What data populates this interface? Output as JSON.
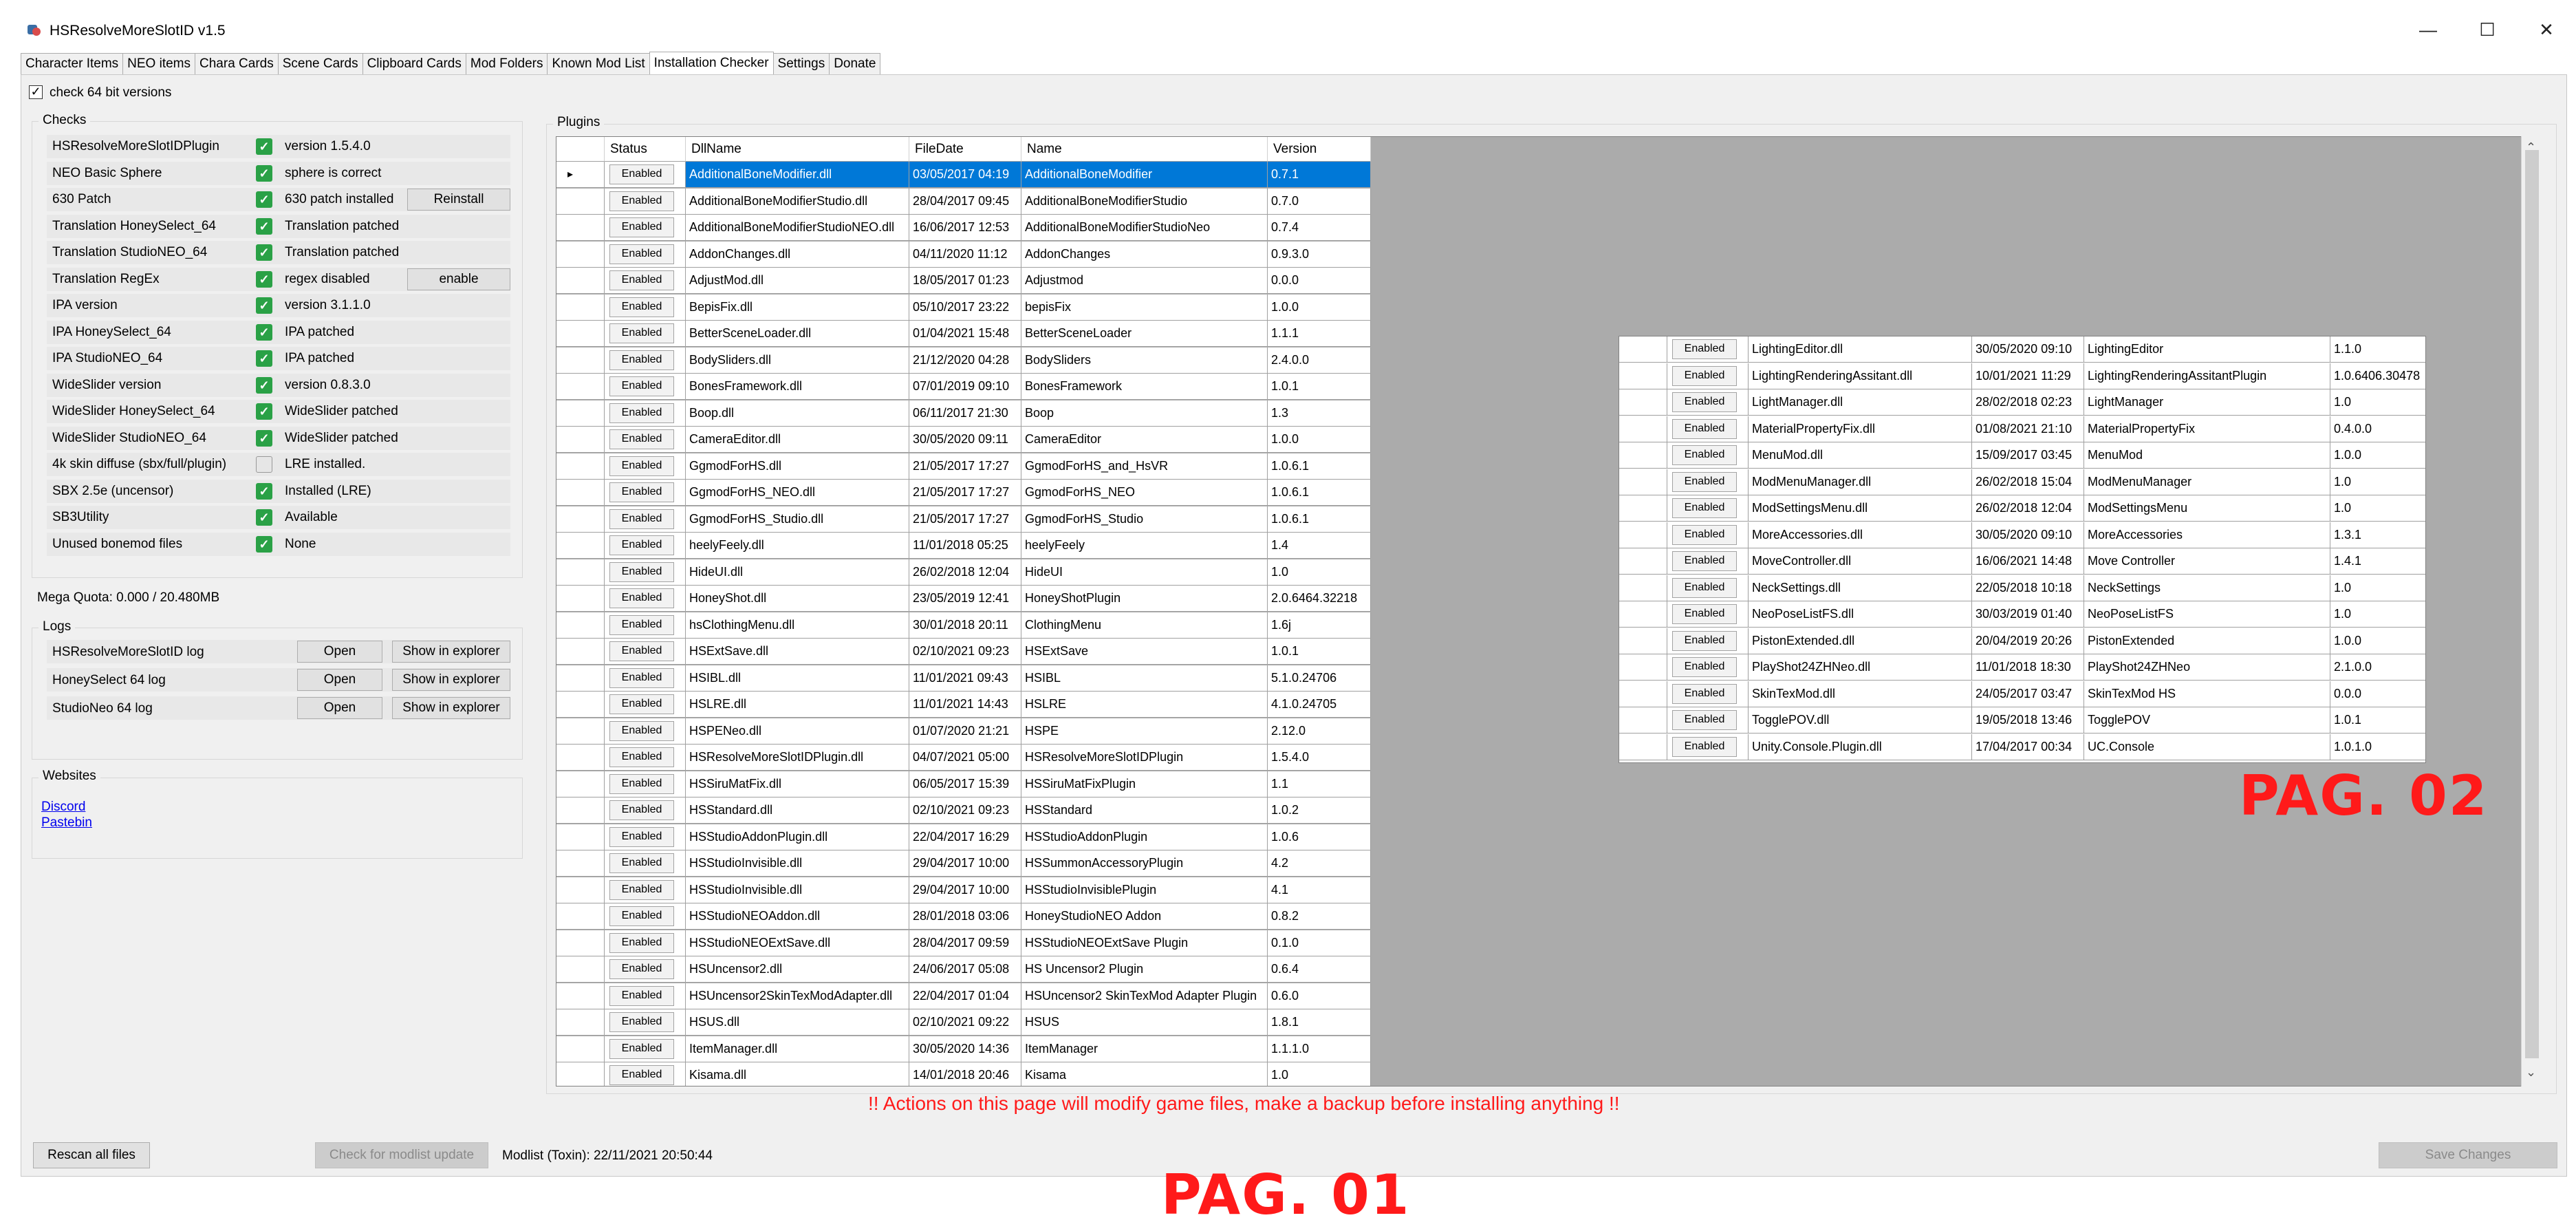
{
  "window": {
    "title": "HSResolveMoreSlotID v1.5",
    "minimize_glyph": "—",
    "maximize_glyph": "☐",
    "close_glyph": "✕"
  },
  "tabs": [
    "Character Items",
    "NEO items",
    "Chara Cards",
    "Scene Cards",
    "Clipboard Cards",
    "Mod Folders",
    "Known Mod List",
    "Installation Checker",
    "Settings",
    "Donate"
  ],
  "active_tab": "Installation Checker",
  "check64": {
    "label": "check 64 bit versions",
    "checked": true
  },
  "checks": {
    "title": "Checks",
    "items": [
      {
        "name": "HSResolveMoreSlotIDPlugin",
        "ok": true,
        "status": "version 1.5.4.0",
        "button": ""
      },
      {
        "name": "NEO Basic Sphere",
        "ok": true,
        "status": "sphere is correct",
        "button": ""
      },
      {
        "name": "630 Patch",
        "ok": true,
        "status": "630 patch installed",
        "button": "Reinstall"
      },
      {
        "name": "Translation HoneySelect_64",
        "ok": true,
        "status": "Translation patched",
        "button": ""
      },
      {
        "name": "Translation StudioNEO_64",
        "ok": true,
        "status": "Translation patched",
        "button": ""
      },
      {
        "name": "Translation RegEx",
        "ok": true,
        "status": "regex disabled",
        "button": "enable"
      },
      {
        "name": "IPA version",
        "ok": true,
        "status": "version 3.1.1.0",
        "button": ""
      },
      {
        "name": "IPA HoneySelect_64",
        "ok": true,
        "status": "IPA patched",
        "button": ""
      },
      {
        "name": "IPA StudioNEO_64",
        "ok": true,
        "status": "IPA patched",
        "button": ""
      },
      {
        "name": "WideSlider version",
        "ok": true,
        "status": "version 0.8.3.0",
        "button": ""
      },
      {
        "name": "WideSlider HoneySelect_64",
        "ok": true,
        "status": "WideSlider patched",
        "button": ""
      },
      {
        "name": "WideSlider StudioNEO_64",
        "ok": true,
        "status": "WideSlider patched",
        "button": ""
      },
      {
        "name": "4k skin diffuse (sbx/full/plugin)",
        "ok": false,
        "status": "LRE installed.",
        "button": ""
      },
      {
        "name": "SBX 2.5e (uncensor)",
        "ok": true,
        "status": "Installed (LRE)",
        "button": ""
      },
      {
        "name": "SB3Utility",
        "ok": true,
        "status": "Available",
        "button": ""
      },
      {
        "name": "Unused bonemod files",
        "ok": true,
        "status": "None",
        "button": ""
      }
    ]
  },
  "mega_quota": "Mega Quota:  0.000 / 20.480MB",
  "logs": {
    "title": "Logs",
    "open_label": "Open",
    "explorer_label": "Show in explorer",
    "items": [
      "HSResolveMoreSlotID log",
      "HoneySelect 64 log",
      "StudioNeo 64 log"
    ]
  },
  "websites": {
    "title": "Websites",
    "links": [
      "Discord",
      "Pastebin"
    ]
  },
  "plugins": {
    "title": "Plugins",
    "headers": [
      "Status",
      "DllName",
      "FileDate",
      "Name",
      "Version"
    ],
    "status_label": "Enabled",
    "rows": [
      [
        "AdditionalBoneModifier.dll",
        "03/05/2017 04:19",
        "AdditionalBoneModifier",
        "0.7.1"
      ],
      [
        "AdditionalBoneModifierStudio.dll",
        "28/04/2017 09:45",
        "AdditionalBoneModifierStudio",
        "0.7.0"
      ],
      [
        "AdditionalBoneModifierStudioNEO.dll",
        "16/06/2017 12:53",
        "AdditionalBoneModifierStudioNeo",
        "0.7.4"
      ],
      [
        "AddonChanges.dll",
        "04/11/2020 11:12",
        "AddonChanges",
        "0.9.3.0"
      ],
      [
        "AdjustMod.dll",
        "18/05/2017 01:23",
        "Adjustmod",
        "0.0.0"
      ],
      [
        "BepisFix.dll",
        "05/10/2017 23:22",
        "bepisFix",
        "1.0.0"
      ],
      [
        "BetterSceneLoader.dll",
        "01/04/2021 15:48",
        "BetterSceneLoader",
        "1.1.1"
      ],
      [
        "BodySliders.dll",
        "21/12/2020 04:28",
        "BodySliders",
        "2.4.0.0"
      ],
      [
        "BonesFramework.dll",
        "07/01/2019 09:10",
        "BonesFramework",
        "1.0.1"
      ],
      [
        "Boop.dll",
        "06/11/2017 21:30",
        "Boop",
        "1.3"
      ],
      [
        "CameraEditor.dll",
        "30/05/2020 09:11",
        "CameraEditor",
        "1.0.0"
      ],
      [
        "GgmodForHS.dll",
        "21/05/2017 17:27",
        "GgmodForHS_and_HsVR",
        "1.0.6.1"
      ],
      [
        "GgmodForHS_NEO.dll",
        "21/05/2017 17:27",
        "GgmodForHS_NEO",
        "1.0.6.1"
      ],
      [
        "GgmodForHS_Studio.dll",
        "21/05/2017 17:27",
        "GgmodForHS_Studio",
        "1.0.6.1"
      ],
      [
        "heelyFeely.dll",
        "11/01/2018 05:25",
        "heelyFeely",
        "1.4"
      ],
      [
        "HideUI.dll",
        "26/02/2018 12:04",
        "HideUI",
        "1.0"
      ],
      [
        "HoneyShot.dll",
        "23/05/2019 12:41",
        "HoneyShotPlugin",
        "2.0.6464.32218"
      ],
      [
        "hsClothingMenu.dll",
        "30/01/2018 20:11",
        "ClothingMenu",
        "1.6j"
      ],
      [
        "HSExtSave.dll",
        "02/10/2021 09:23",
        "HSExtSave",
        "1.0.1"
      ],
      [
        "HSIBL.dll",
        "11/01/2021 09:43",
        "HSIBL",
        "5.1.0.24706"
      ],
      [
        "HSLRE.dll",
        "11/01/2021 14:43",
        "HSLRE",
        "4.1.0.24705"
      ],
      [
        "HSPENeo.dll",
        "01/07/2020 21:21",
        "HSPE",
        "2.12.0"
      ],
      [
        "HSResolveMoreSlotIDPlugin.dll",
        "04/07/2021 05:00",
        "HSResolveMoreSlotIDPlugin",
        "1.5.4.0"
      ],
      [
        "HSSiruMatFix.dll",
        "06/05/2017 15:39",
        "HSSiruMatFixPlugin",
        "1.1"
      ],
      [
        "HSStandard.dll",
        "02/10/2021 09:23",
        "HSStandard",
        "1.0.2"
      ],
      [
        "HSStudioAddonPlugin.dll",
        "22/04/2017 16:29",
        "HSStudioAddonPlugin",
        "1.0.6"
      ],
      [
        "HSStudioInvisible.dll",
        "29/04/2017 10:00",
        "HSSummonAccessoryPlugin",
        "4.2"
      ],
      [
        "HSStudioInvisible.dll",
        "29/04/2017 10:00",
        "HSStudioInvisiblePlugin",
        "4.1"
      ],
      [
        "HSStudioNEOAddon.dll",
        "28/01/2018 03:06",
        "HoneyStudioNEO Addon",
        "0.8.2"
      ],
      [
        "HSStudioNEOExtSave.dll",
        "28/04/2017 09:59",
        "HSStudioNEOExtSave Plugin",
        "0.1.0"
      ],
      [
        "HSUncensor2.dll",
        "24/06/2017 05:08",
        "HS Uncensor2 Plugin",
        "0.6.4"
      ],
      [
        "HSUncensor2SkinTexModAdapter.dll",
        "22/04/2017 01:04",
        "HSUncensor2 SkinTexMod Adapter Plugin",
        "0.6.0"
      ],
      [
        "HSUS.dll",
        "02/10/2021 09:22",
        "HSUS",
        "1.8.1"
      ],
      [
        "ItemManager.dll",
        "30/05/2020 14:36",
        "ItemManager",
        "1.1.1.0"
      ],
      [
        "Kisama.dll",
        "14/01/2018 20:46",
        "Kisama",
        "1.0"
      ]
    ],
    "rows_page2": [
      [
        "LightingEditor.dll",
        "30/05/2020 09:10",
        "LightingEditor",
        "1.1.0"
      ],
      [
        "LightingRenderingAssitant.dll",
        "10/01/2021 11:29",
        "LightingRenderingAssitantPlugin",
        "1.0.6406.30478"
      ],
      [
        "LightManager.dll",
        "28/02/2018 02:23",
        "LightManager",
        "1.0"
      ],
      [
        "MaterialPropertyFix.dll",
        "01/08/2021 21:10",
        "MaterialPropertyFix",
        "0.4.0.0"
      ],
      [
        "MenuMod.dll",
        "15/09/2017 03:45",
        "MenuMod",
        "1.0.0"
      ],
      [
        "ModMenuManager.dll",
        "26/02/2018 15:04",
        "ModMenuManager",
        "1.0"
      ],
      [
        "ModSettingsMenu.dll",
        "26/02/2018 12:04",
        "ModSettingsMenu",
        "1.0"
      ],
      [
        "MoreAccessories.dll",
        "30/05/2020 09:10",
        "MoreAccessories",
        "1.3.1"
      ],
      [
        "MoveController.dll",
        "16/06/2021 14:48",
        "Move Controller",
        "1.4.1"
      ],
      [
        "NeckSettings.dll",
        "22/05/2018 10:18",
        "NeckSettings",
        "1.0"
      ],
      [
        "NeoPoseListFS.dll",
        "30/03/2019 01:40",
        "NeoPoseListFS",
        "1.0"
      ],
      [
        "PistonExtended.dll",
        "20/04/2019 20:26",
        "PistonExtended",
        "1.0.0"
      ],
      [
        "PlayShot24ZHNeo.dll",
        "11/01/2018 18:30",
        "PlayShot24ZHNeo",
        "2.1.0.0"
      ],
      [
        "SkinTexMod.dll",
        "24/05/2017 03:47",
        "SkinTexMod HS",
        "0.0.0"
      ],
      [
        "TogglePOV.dll",
        "19/05/2018 13:46",
        "TogglePOV",
        "1.0.1"
      ],
      [
        "Unity.Console.Plugin.dll",
        "17/04/2017 00:34",
        "UC.Console",
        "1.0.1.0"
      ]
    ]
  },
  "warning": "!! Actions on this page will modify game files, make a backup before installing anything  !!",
  "bottom": {
    "rescan_label": "Rescan all files",
    "modlist_update_label": "Check for modlist update",
    "modlist_text": "Modlist (Toxin): 22/11/2021 20:50:44",
    "save_label": "Save Changes"
  },
  "page_labels": {
    "page1": "PAG. 01",
    "page2": "PAG. 02"
  },
  "colors": {
    "selection": "#0078d7",
    "ok_green": "#2aa146",
    "warning_red": "#ff1a1a"
  }
}
